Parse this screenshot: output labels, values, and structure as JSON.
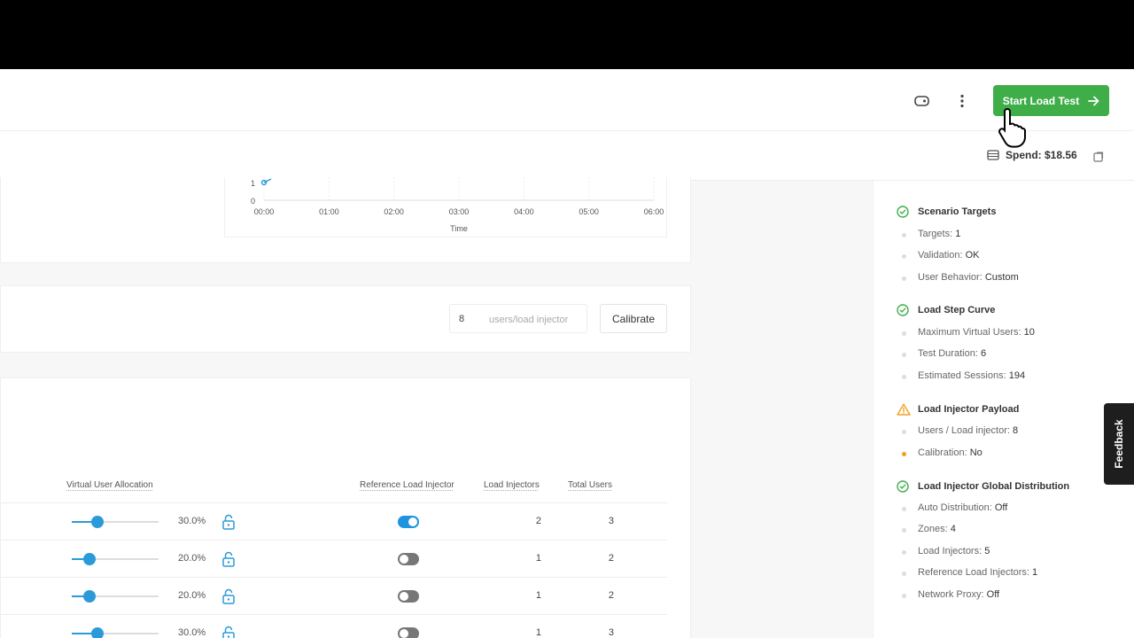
{
  "header": {
    "start_label": "Start Load Test",
    "tag_icon": "tag-icon",
    "more_icon": "more-vertical-icon",
    "arrow_icon": "arrow-right-icon"
  },
  "subbar": {
    "spend_label": "Spend: $18.56"
  },
  "chart": {
    "y_ticks": [
      "1",
      "0"
    ],
    "x_ticks": [
      "00:00",
      "01:00",
      "02:00",
      "03:00",
      "04:00",
      "05:00",
      "06:00"
    ],
    "xlabel": "Time"
  },
  "chart_data": {
    "type": "line",
    "x": [
      "00:00",
      "01:00",
      "02:00",
      "03:00",
      "04:00",
      "05:00",
      "06:00"
    ],
    "xlabel": "Time",
    "ylabel": "",
    "y_ticks": [
      0,
      1
    ],
    "series": [
      {
        "values": [
          1,
          null,
          null,
          null,
          null,
          null,
          null
        ]
      }
    ]
  },
  "calibration": {
    "users_value": "8",
    "users_placeholder": "users/load injector",
    "calibrate_label": "Calibrate"
  },
  "allocation": {
    "headers": {
      "vu_allocation": "Virtual User Allocation",
      "reference": "Reference Load Injector",
      "injectors": "Load Injectors",
      "total": "Total Users"
    },
    "rows": [
      {
        "pct": "30.0%",
        "fraction": 0.3,
        "reference": true,
        "injectors": "2",
        "total": "3"
      },
      {
        "pct": "20.0%",
        "fraction": 0.2,
        "reference": false,
        "injectors": "1",
        "total": "2"
      },
      {
        "pct": "20.0%",
        "fraction": 0.2,
        "reference": false,
        "injectors": "1",
        "total": "2"
      },
      {
        "pct": "30.0%",
        "fraction": 0.3,
        "reference": false,
        "injectors": "1",
        "total": "3"
      }
    ]
  },
  "summary": {
    "scenario": {
      "title": "Scenario Targets",
      "status": "ok",
      "items": [
        {
          "label": "Targets:",
          "value": "1"
        },
        {
          "label": "Validation:",
          "value": "OK"
        },
        {
          "label": "User Behavior:",
          "value": "Custom"
        }
      ]
    },
    "curve": {
      "title": "Load Step Curve",
      "status": "ok",
      "items": [
        {
          "label": "Maximum Virtual Users:",
          "value": "10"
        },
        {
          "label": "Test Duration:",
          "value": "6"
        },
        {
          "label": "Estimated Sessions:",
          "value": "194"
        }
      ]
    },
    "payload": {
      "title": "Load Injector Payload",
      "status": "warning",
      "items": [
        {
          "label": "Users / Load injector:",
          "value": "8"
        },
        {
          "label": "Calibration:",
          "value": "No"
        }
      ]
    },
    "distribution": {
      "title": "Load Injector Global Distribution",
      "status": "ok",
      "items": [
        {
          "label": "Auto Distribution:",
          "value": "Off"
        },
        {
          "label": "Zones:",
          "value": "4"
        },
        {
          "label": "Load Injectors:",
          "value": "5"
        },
        {
          "label": "Reference Load Injectors:",
          "value": "1"
        },
        {
          "label": "Network Proxy:",
          "value": "Off"
        }
      ]
    }
  },
  "feedback_label": "Feedback",
  "colors": {
    "accent_green": "#3fae49",
    "accent_blue": "#2a9bd8",
    "warning": "#f0a020"
  }
}
